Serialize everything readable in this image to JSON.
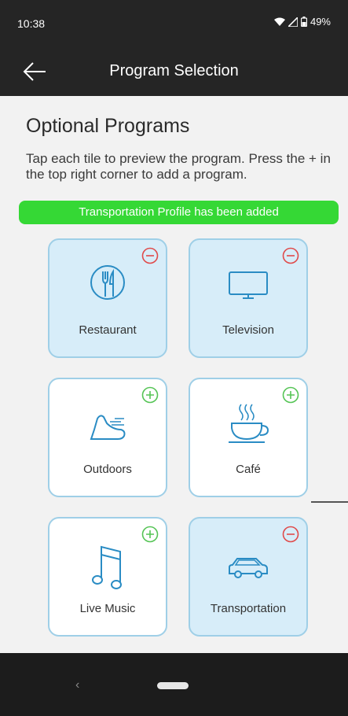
{
  "status_bar": {
    "time": "10:38",
    "battery": "49%"
  },
  "app_bar": {
    "title": "Program Selection",
    "back_icon": "arrow-left-icon"
  },
  "main": {
    "section_title": "Optional Programs",
    "instructions": "Tap each tile to preview the program. Press the + in the top right corner to add a program.",
    "banner": "Transportation Profile has been added",
    "colors": {
      "banner": "#35d835",
      "remove": "#e04a4a",
      "add": "#55c455",
      "tile_selected": "#d7edf9",
      "tile_border": "#9fcfe7",
      "icon": "#2a8cc4"
    },
    "tiles": [
      {
        "label": "Restaurant",
        "icon": "fork-knife-icon",
        "selected": true,
        "toggle": "remove-icon"
      },
      {
        "label": "Television",
        "icon": "television-icon",
        "selected": true,
        "toggle": "remove-icon"
      },
      {
        "label": "Outdoors",
        "icon": "running-shoe-icon",
        "selected": false,
        "toggle": "add-icon"
      },
      {
        "label": "Café",
        "icon": "coffee-cup-icon",
        "selected": false,
        "toggle": "add-icon"
      },
      {
        "label": "Live Music",
        "icon": "music-note-icon",
        "selected": false,
        "toggle": "add-icon"
      },
      {
        "label": "Transportation",
        "icon": "car-icon",
        "selected": true,
        "toggle": "remove-icon"
      }
    ]
  }
}
